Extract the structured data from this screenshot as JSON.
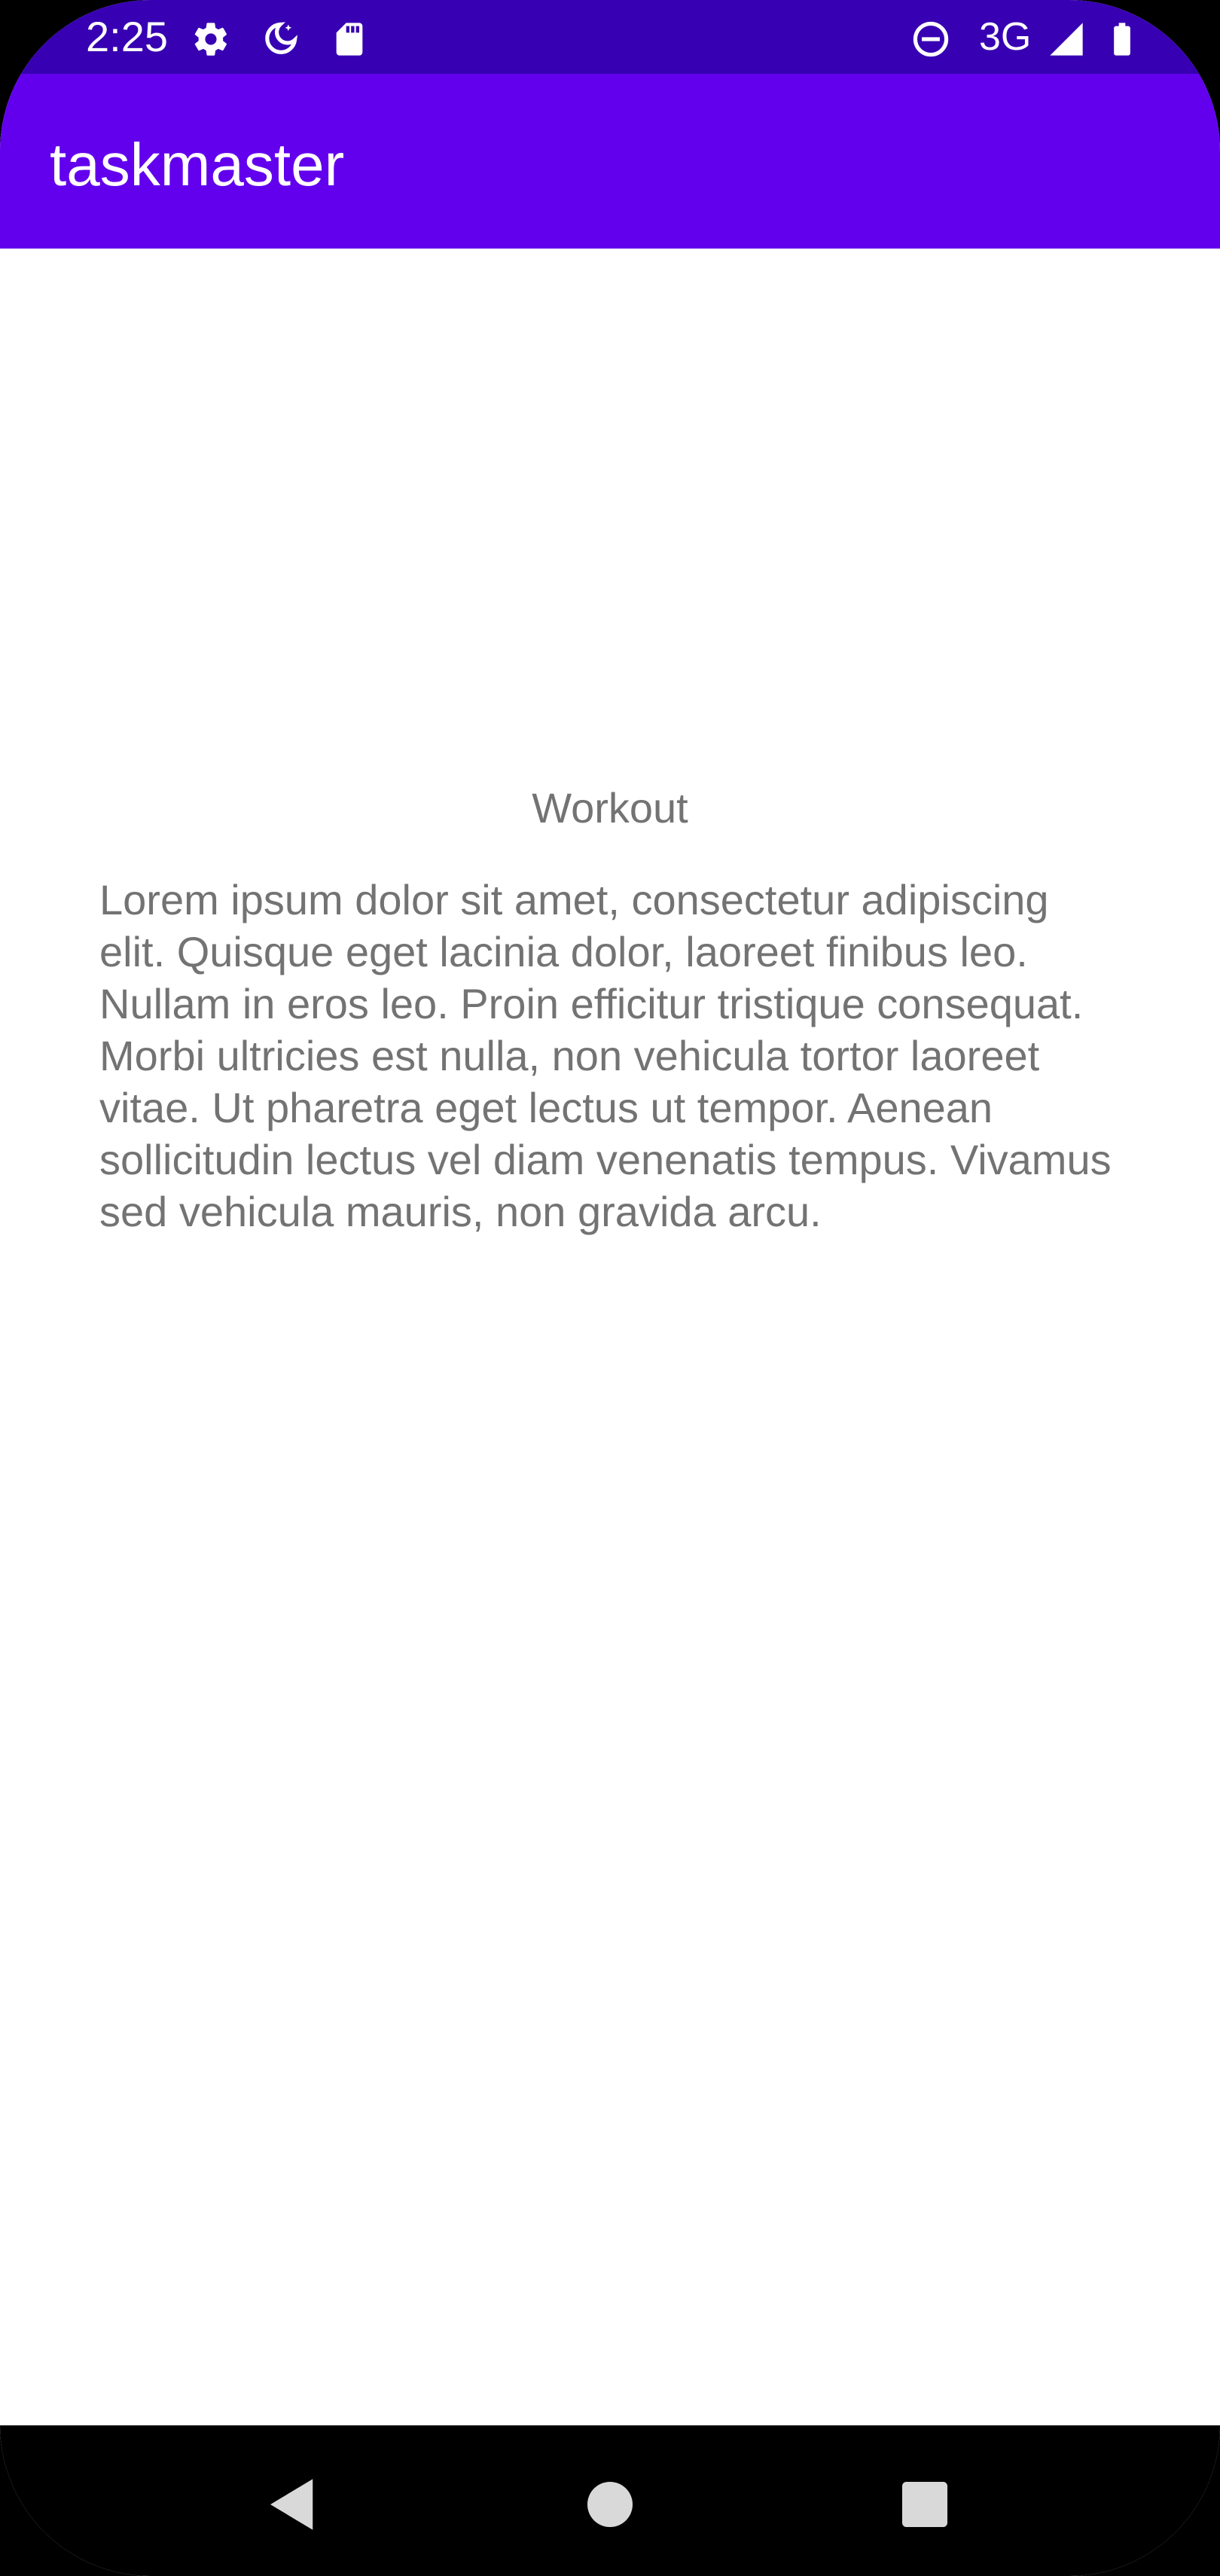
{
  "status_bar": {
    "time": "2:25",
    "network": "3G",
    "icons": [
      "settings-icon",
      "do-not-disturb-moon-icon",
      "sd-card-icon",
      "dnd-minus-icon",
      "signal-icon",
      "battery-icon"
    ],
    "background": "#3700B3"
  },
  "app_bar": {
    "title": "taskmaster",
    "background": "#6200EE"
  },
  "task": {
    "title": "Workout",
    "body": "Lorem ipsum dolor sit amet, consectetur adipiscing elit. Quisque eget lacinia dolor, laoreet finibus leo. Nullam in eros leo. Proin efficitur tristique consequat. Morbi ultricies est nulla, non vehicula tortor laoreet vitae. Ut pharetra eget lectus ut tempor. Aenean sollicitudin lectus vel diam venenatis tempus. Vivamus sed vehicula mauris, non gravida arcu."
  },
  "nav_bar": {
    "buttons": [
      "back-icon",
      "home-icon",
      "recents-icon"
    ]
  }
}
